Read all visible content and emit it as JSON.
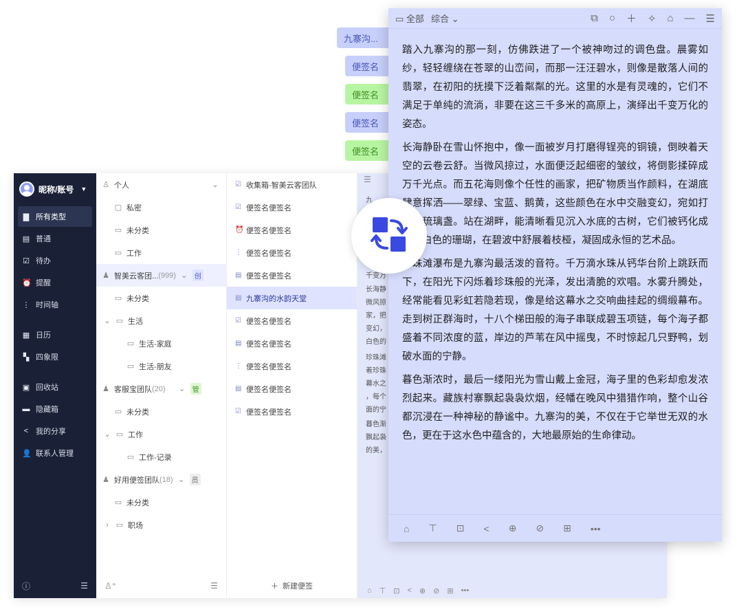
{
  "sidebar": {
    "user": "昵称/账号",
    "items": [
      {
        "label": "所有类型",
        "icon": "bookmark-icon"
      },
      {
        "label": "普通",
        "icon": "note-icon"
      },
      {
        "label": "待办",
        "icon": "checkbox-icon"
      },
      {
        "label": "提醒",
        "icon": "alarm-icon"
      },
      {
        "label": "时间轴",
        "icon": "timeline-icon"
      },
      {
        "label": "日历",
        "icon": "calendar-icon"
      },
      {
        "label": "四象限",
        "icon": "quadrant-icon"
      },
      {
        "label": "回收站",
        "icon": "trash-icon"
      },
      {
        "label": "隐藏箱",
        "icon": "hidden-box-icon"
      },
      {
        "label": "我的分享",
        "icon": "share-icon"
      },
      {
        "label": "联系人管理",
        "icon": "contacts-icon"
      }
    ]
  },
  "folders": {
    "personal": "个人",
    "private": "私密",
    "uncategorized": "未分类",
    "work": "工作",
    "team1": {
      "name": "智美云客团...",
      "count": "(999)",
      "badge": "创"
    },
    "life": "生活",
    "life_home": "生活-家庭",
    "life_friends": "生活-朋友",
    "team2": {
      "name": "客服宝团队",
      "count": "(20)",
      "badge": "管"
    },
    "work_record": "工作-记录",
    "team3": {
      "name": "好用便签团队",
      "count": "(18)",
      "badge": "员"
    },
    "workplace": "职场"
  },
  "notes": {
    "items": [
      "收集箱-智美云客团队",
      "便签名便签名",
      "便签名便签名",
      "便签名便签名",
      "便签名便签名",
      "九寨沟的水韵天堂",
      "便签名便签名",
      "便签名便签名",
      "便签名便签名",
      "便签名便签名",
      "便签名便签名"
    ],
    "new_note": "新建便签"
  },
  "preview": {
    "lines": [
      "九",
      "千变万",
      "长海静",
      "微风掠",
      "家，把",
      "变幻，",
      "白色的",
      "珍珠滩",
      "着珍珠",
      "幕水之",
      "，每个",
      "面的宁",
      "暮色渐",
      "飘起袅",
      "的美，"
    ]
  },
  "tabs": [
    {
      "label": "九寨沟...",
      "color": "blue"
    },
    {
      "label": "便签名",
      "color": "blue"
    },
    {
      "label": "便签名",
      "color": "green"
    },
    {
      "label": "便签名",
      "color": "blue"
    },
    {
      "label": "便签名",
      "color": "green"
    }
  ],
  "note_window": {
    "filter_all": "全部",
    "filter_sort": "综合",
    "paragraphs": [
      "踏入九寨沟的那一刻，仿佛跌进了一个被神吻过的调色盘。晨雾如纱，轻轻缠绕在苍翠的山峦间，而那一汪汪碧水，则像是散落人间的翡翠，在初阳的抚摸下泛着粼粼的光。这里的水是有灵魂的，它们不满足于单纯的流淌，非要在这三千多米的高原上，演绎出千变万化的姿态。",
      "长海静卧在雪山怀抱中，像一面被岁月打磨得锃亮的铜镜，倒映着天空的云卷云舒。当微风掠过，水面便泛起细密的皱纹，将倒影揉碎成万千光点。而五花海则像个任性的画家，把矿物质当作颜料，在湖底肆意挥洒——翠绿、宝蓝、鹅黄，这些颜色在水中交融变幻，宛如打翻的琉璃盏。站在湖畔，能清晰看见沉入水底的古树，它们被钙化成了玉白色的珊瑚，在碧波中舒展着枝桠，凝固成永恒的艺术品。",
      "珍珠滩瀑布是九寨沟最活泼的音符。千万滴水珠从钙华台阶上跳跃而下，在阳光下闪烁着珍珠般的光泽，发出清脆的欢唱。水雾升腾处，经常能看见彩虹若隐若现，像是给这幕水之交响曲挂起的绸缎幕布。走到树正群海时，十八个梯田般的海子串联成碧玉项链，每个海子都盛着不同浓度的蓝，岸边的芦苇在风中摇曳，不时惊起几只野鸭，划破水面的宁静。",
      "暮色渐浓时，最后一缕阳光为雪山戴上金冠，海子里的色彩却愈发浓烈起来。藏族村寨飘起袅袅炊烟，经幡在晚风中猎猎作响，整个山谷都沉浸在一种神秘的静谧中。九寨沟的美，不仅在于它举世无双的水色，更在于这水色中蕴含的，大地最原始的生命律动。"
    ]
  }
}
